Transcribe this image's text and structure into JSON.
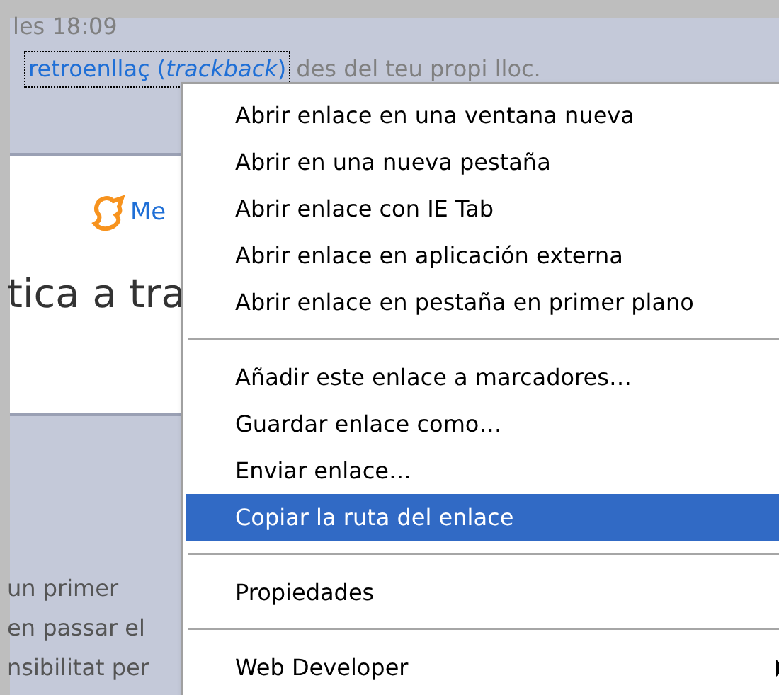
{
  "page": {
    "timestamp": "les 18:09",
    "trackback_link": "retroenllaç (*trackback*)",
    "trackback_tail": "des del teu propi lloc.",
    "card_link": "Me",
    "card_heading": "tica a tra",
    "body_lines": [
      "un primer",
      "en passar el",
      "nsibilitat per"
    ]
  },
  "context_menu": {
    "items": [
      {
        "kind": "item",
        "label": "Abrir enlace en una ventana nueva",
        "selected": false
      },
      {
        "kind": "item",
        "label": "Abrir en una nueva pestaña",
        "selected": false
      },
      {
        "kind": "item",
        "label": "Abrir enlace con IE Tab",
        "selected": false
      },
      {
        "kind": "item",
        "label": "Abrir enlace en aplicación externa",
        "selected": false
      },
      {
        "kind": "item",
        "label": "Abrir enlace en pestaña en primer plano",
        "selected": false
      },
      {
        "kind": "separator"
      },
      {
        "kind": "item",
        "label": "Añadir este enlace a marcadores…",
        "selected": false
      },
      {
        "kind": "item",
        "label": "Guardar enlace como…",
        "selected": false
      },
      {
        "kind": "item",
        "label": "Enviar enlace…",
        "selected": false
      },
      {
        "kind": "item",
        "label": "Copiar la ruta del enlace",
        "selected": true
      },
      {
        "kind": "separator"
      },
      {
        "kind": "item",
        "label": "Propiedades",
        "selected": false
      },
      {
        "kind": "separator"
      },
      {
        "kind": "submenu",
        "label": "Web Developer",
        "selected": false
      }
    ]
  }
}
